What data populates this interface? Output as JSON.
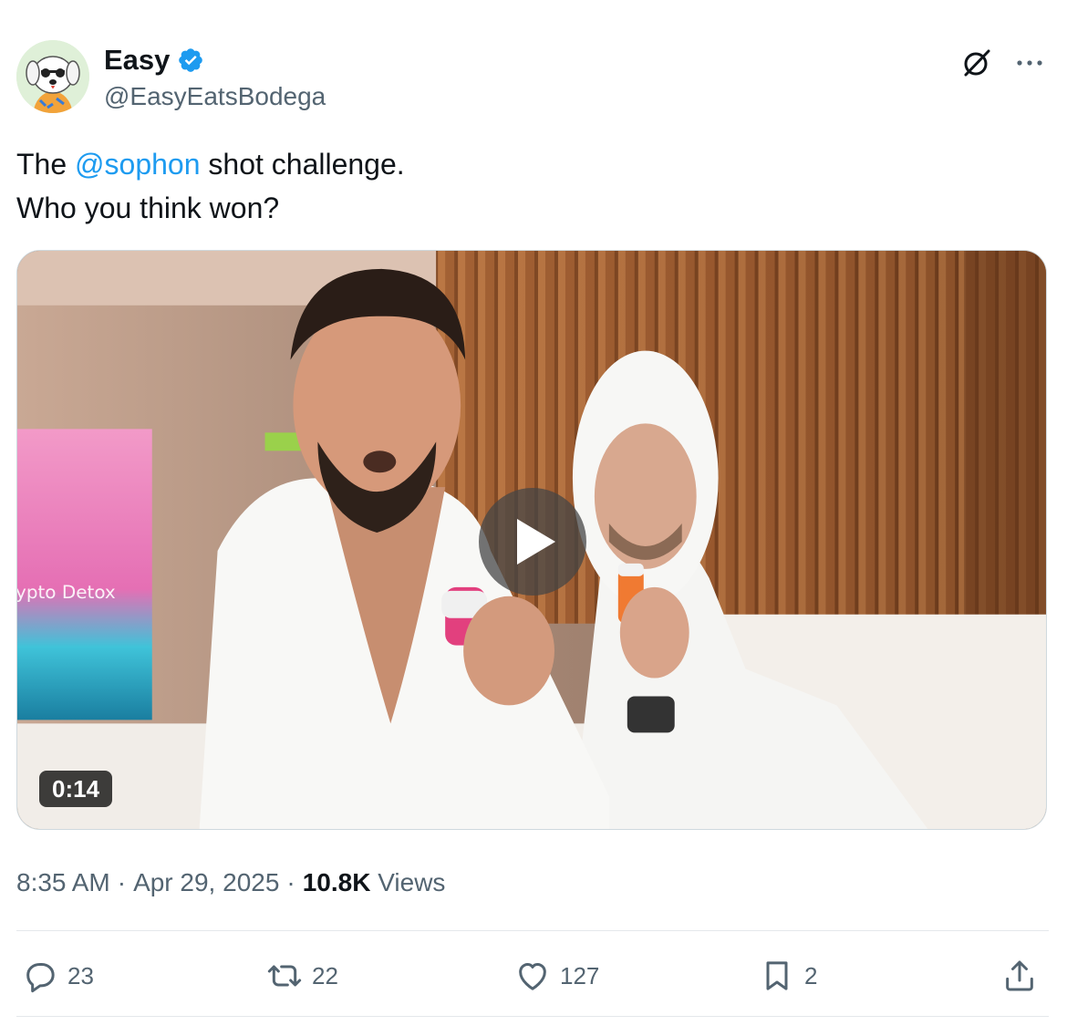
{
  "author": {
    "display_name": "Easy",
    "handle": "@EasyEatsBodega",
    "verified": true
  },
  "tweet": {
    "text_before": "The ",
    "mention": "@sophon",
    "text_after": " shot challenge.",
    "line2": "Who you think won?"
  },
  "media": {
    "duration": "0:14",
    "screen_text": "ypto Detox"
  },
  "meta": {
    "time": "8:35 AM",
    "sep": "·",
    "date": "Apr 29, 2025",
    "views_count": "10.8K",
    "views_label": "Views"
  },
  "actions": {
    "replies": "23",
    "reposts": "22",
    "likes": "127",
    "bookmarks": "2"
  },
  "colors": {
    "accent": "#1d9bf0",
    "secondary_text": "#536471"
  },
  "icons": [
    "grok-icon",
    "more-icon",
    "verified-badge-icon",
    "play-icon",
    "reply-icon",
    "repost-icon",
    "like-icon",
    "bookmark-icon",
    "share-icon"
  ]
}
